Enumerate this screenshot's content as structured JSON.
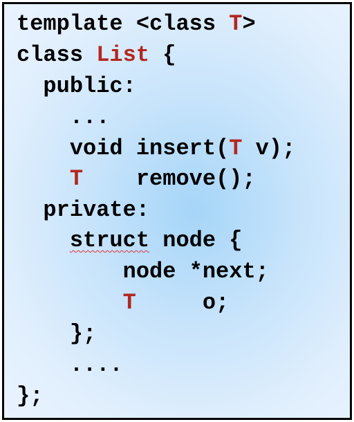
{
  "colors": {
    "border": "#000000",
    "background_center": "#a6d5f8",
    "background_edge": "#eaf3fe",
    "text": "#000000",
    "type_param": "#b3271f",
    "spellcheck_underline": "#e0323b"
  },
  "code": {
    "line1": {
      "a": "template <class ",
      "type": "T",
      "b": ">"
    },
    "line2": {
      "a": "class ",
      "type": "List",
      "b": " {"
    },
    "line3": {
      "text": "  public:"
    },
    "line4": {
      "text": "    ..."
    },
    "line5": {
      "a": "    void insert(",
      "type": "T",
      "b": " v);"
    },
    "line6": {
      "indent": "    ",
      "type": "T",
      "b": "    remove();"
    },
    "line7": {
      "text": "  private:"
    },
    "line8": {
      "indent": "    ",
      "misspelled": "struct",
      "b": " node {"
    },
    "line9": {
      "text": "        node *next;"
    },
    "line10": {
      "indent": "        ",
      "type": "T",
      "b": "     o;"
    },
    "line11": {
      "text": "    };"
    },
    "line12": {
      "text": "    ...."
    },
    "line13": {
      "text": "};"
    }
  }
}
